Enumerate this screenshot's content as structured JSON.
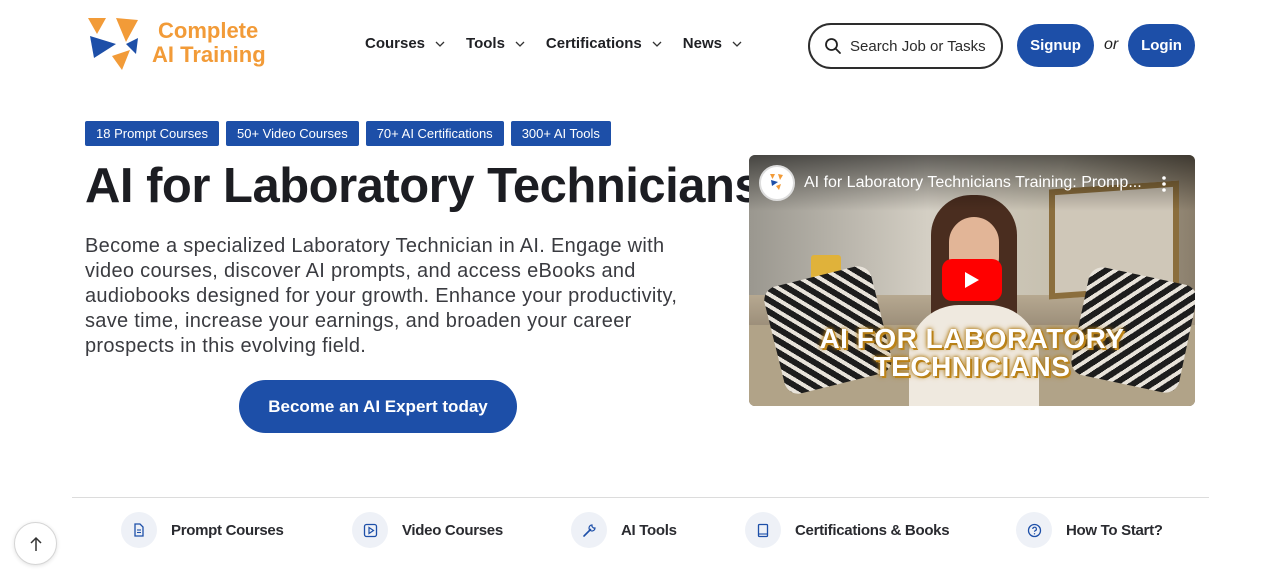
{
  "colors": {
    "primary": "#1d4fa8",
    "logo_orange": "#f29b38",
    "logo_blue": "#1d4fa8",
    "youtube_red": "#ff0000"
  },
  "logo": {
    "line1": "Complete",
    "line2": "AI Training"
  },
  "nav": {
    "items": [
      {
        "label": "Courses",
        "icon": "chevron-down-icon"
      },
      {
        "label": "Tools",
        "icon": "chevron-down-icon"
      },
      {
        "label": "Certifications",
        "icon": "chevron-down-icon"
      },
      {
        "label": "News",
        "icon": "chevron-down-icon"
      }
    ]
  },
  "search": {
    "placeholder": "Search Job or Tasks",
    "icon": "search-icon"
  },
  "auth": {
    "signup_label": "Signup",
    "or_text": "or",
    "login_label": "Login"
  },
  "badges": [
    "18 Prompt Courses",
    "50+ Video Courses",
    "70+ AI Certifications",
    "300+ AI Tools"
  ],
  "hero": {
    "title": "AI for Laboratory Technicians",
    "description": "Become a specialized Laboratory Technician in AI. Engage with video courses, discover AI prompts, and access eBooks and audiobooks designed for your growth. Enhance your productivity, save time, increase your earnings, and broaden your career prospects in this evolving field.",
    "cta_label": "Become an AI Expert today"
  },
  "video": {
    "title": "AI for Laboratory Technicians Training: Promp...",
    "overlay_line1": "AI FOR LABORATORY",
    "overlay_line2": "TECHNICIANS",
    "play_icon": "play-icon",
    "menu_icon": "more-vertical-icon"
  },
  "bottom_nav": [
    {
      "label": "Prompt Courses",
      "icon": "document-icon"
    },
    {
      "label": "Video Courses",
      "icon": "play-square-icon"
    },
    {
      "label": "AI Tools",
      "icon": "wrench-icon"
    },
    {
      "label": "Certifications & Books",
      "icon": "book-icon"
    },
    {
      "label": "How To Start?",
      "icon": "question-circle-icon"
    }
  ],
  "back_to_top_icon": "arrow-up-icon"
}
